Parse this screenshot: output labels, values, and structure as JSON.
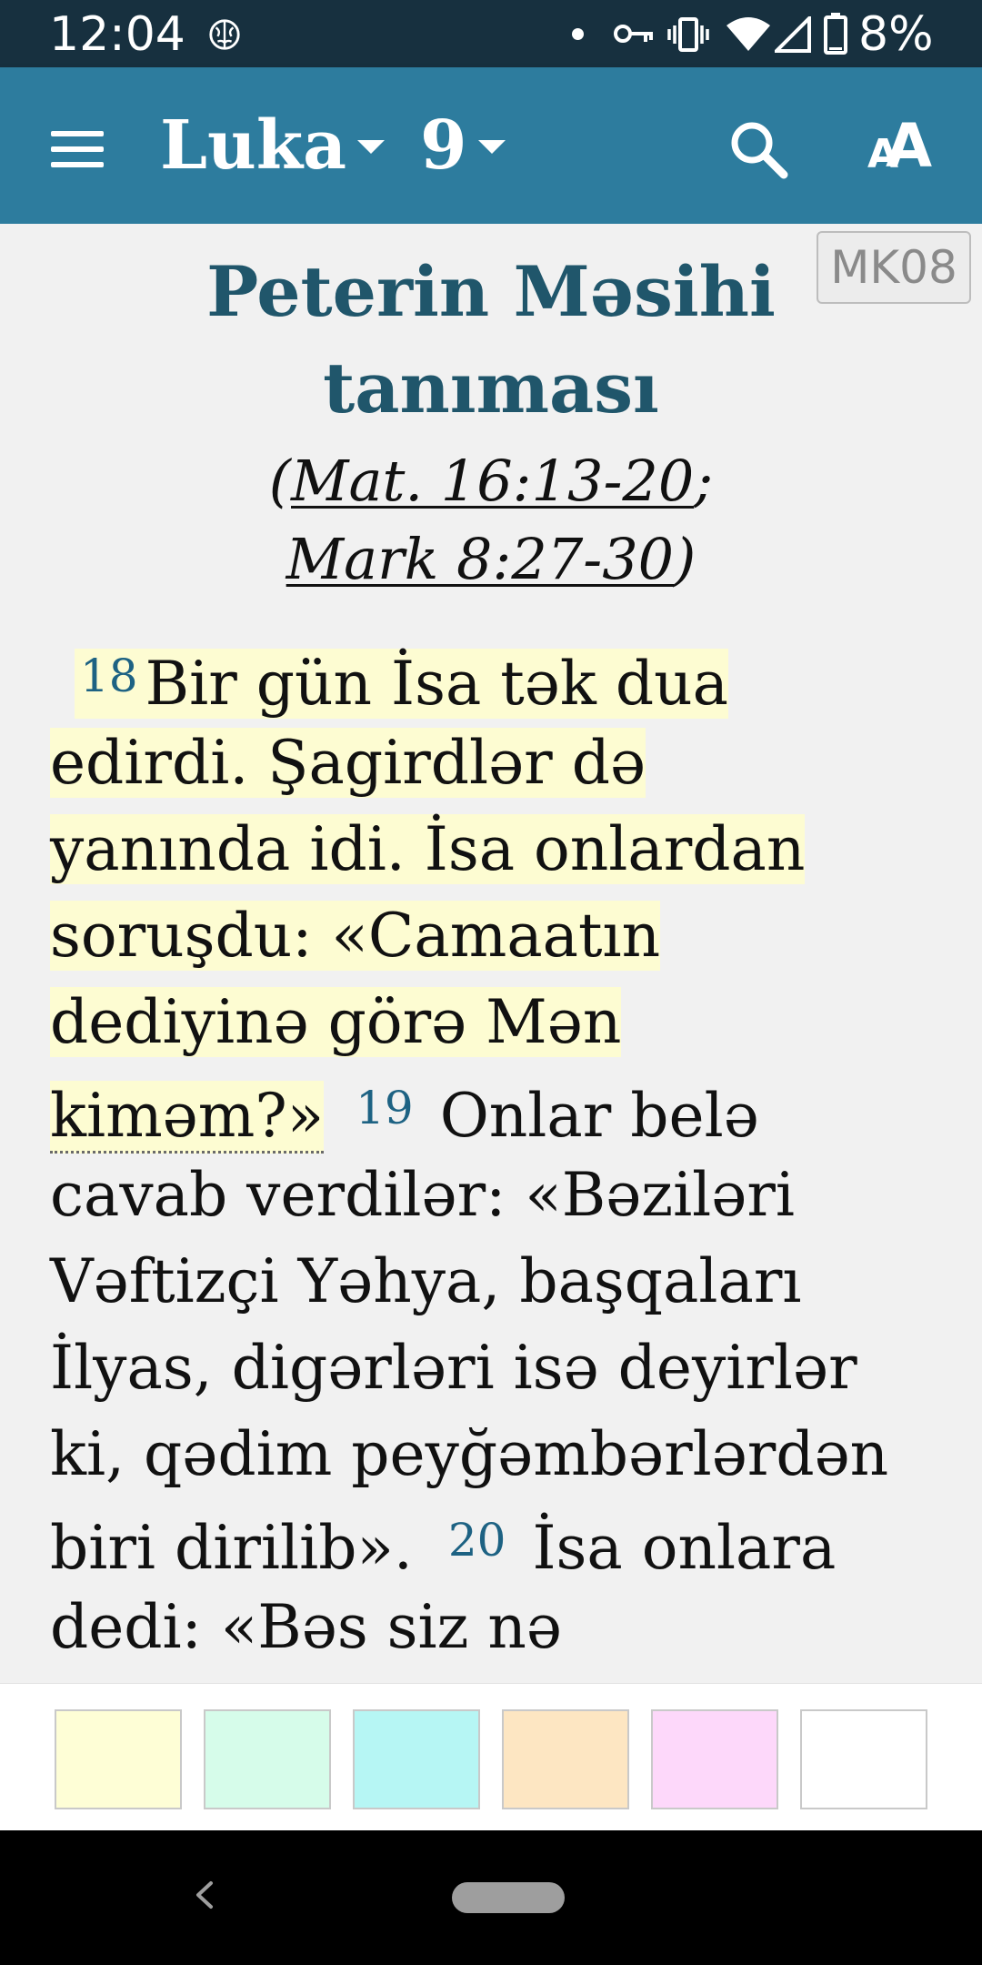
{
  "status_bar": {
    "time": "12:04",
    "battery_percent": "8%",
    "icons": [
      "brain-icon",
      "notification-dot-icon",
      "vpn-key-icon",
      "vibrate-icon",
      "wifi-icon",
      "cell-signal-icon",
      "battery-icon"
    ]
  },
  "app_bar": {
    "background": "#2d7c9e",
    "book": "Luka",
    "chapter": "9",
    "icons": [
      "menu-icon",
      "search-icon",
      "font-size-icon"
    ]
  },
  "content": {
    "translation": "MK08",
    "heading_lines": [
      "Peterin Məsihi",
      "tanıması"
    ],
    "refs": {
      "open": "(",
      "ref1": "Mat. 16:13-20",
      "sep": ";",
      "ref2": "Mark 8:27-30",
      "close": ")"
    },
    "verses": {
      "v18": "18",
      "v19": "19",
      "v20": "20",
      "line1": "Bir gün İsa tək dua",
      "line2": "edirdi. Şagirdlər də",
      "line3": "yanında idi. İsa onlardan",
      "line4": "soruşdu: «Camaatın",
      "line5": "dediyinə görə Mən",
      "line6a": "kiməm?»",
      "line6b": "Onlar belə",
      "line7": "cavab verdilər: «Bəziləri",
      "line8": "Vəftizçi Yəhya, başqaları",
      "line9": "İlyas, digərləri isə deyirlər",
      "line10": "ki, qədim peyğəmbərlərdən",
      "line11a": "biri dirilib».",
      "line11b": "İsa onlara",
      "line12": "dedi: «Bəs siz nə"
    },
    "highlight_color": "#fdfcd2"
  },
  "palette": {
    "colors": [
      "#fefed6",
      "#d6fcea",
      "#b6f6f4",
      "#fde6c2",
      "#fdd8fa",
      "#ffffff"
    ]
  }
}
